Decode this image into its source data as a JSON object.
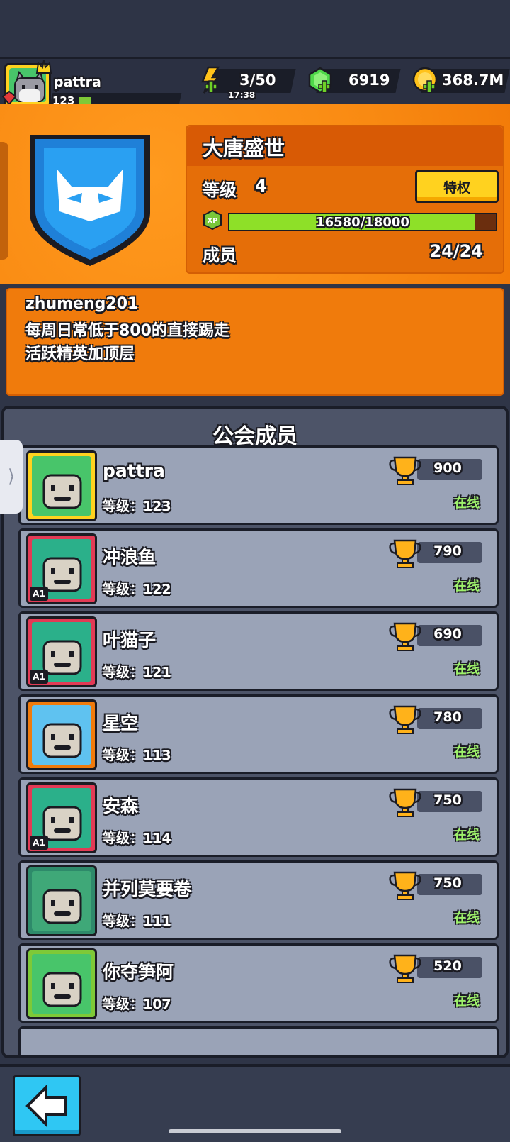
{
  "player": {
    "name": "pattra",
    "level": "123"
  },
  "resources": {
    "energy": "3/50",
    "energy_timer": "17:38",
    "gems": "6919",
    "coins": "368.7M"
  },
  "guild": {
    "name": "大唐盛世",
    "level_label": "等级",
    "level_value": "4",
    "privilege_label": "特权",
    "xp_icon_text": "XP",
    "xp_text": "16580/18000",
    "xp_progress": 0.921,
    "members_label": "成员",
    "members_count": "24/24"
  },
  "notice": {
    "author": "zhumeng201",
    "line1": "每周日常低于800的直接踢走",
    "line2": "活跃精英加顶层"
  },
  "members_panel": {
    "title": "公会成员",
    "handle_glyph": "⟩",
    "members": [
      {
        "name": "pattra",
        "level": "等级：123",
        "score": "900",
        "status": "在线"
      },
      {
        "name": "冲浪鱼",
        "level": "等级：122",
        "score": "790",
        "status": "在线",
        "tag": "A1"
      },
      {
        "name": "叶猫子",
        "level": "等级：121",
        "score": "690",
        "status": "在线",
        "tag": "A1"
      },
      {
        "name": "星空",
        "level": "等级：113",
        "score": "780",
        "status": "在线"
      },
      {
        "name": "安森",
        "level": "等级：114",
        "score": "750",
        "status": "在线",
        "tag": "A1"
      },
      {
        "name": "并列莫要卷",
        "level": "等级：111",
        "score": "750",
        "status": "在线"
      },
      {
        "name": "你夺笋阿",
        "level": "等级：107",
        "score": "520",
        "status": "在线"
      }
    ]
  },
  "colors": {
    "accent_orange": "#f98a12",
    "xp_green": "#8ee028",
    "online_green": "#9ef26b",
    "button_yellow": "#ffd21f",
    "back_blue": "#2fc7f3"
  },
  "icons": {
    "energy": "lightning-icon",
    "gems": "gem-icon",
    "coins": "coin-icon",
    "trophy": "trophy-icon",
    "back": "back-arrow-icon",
    "guild_badge": "cat-shield-icon"
  }
}
